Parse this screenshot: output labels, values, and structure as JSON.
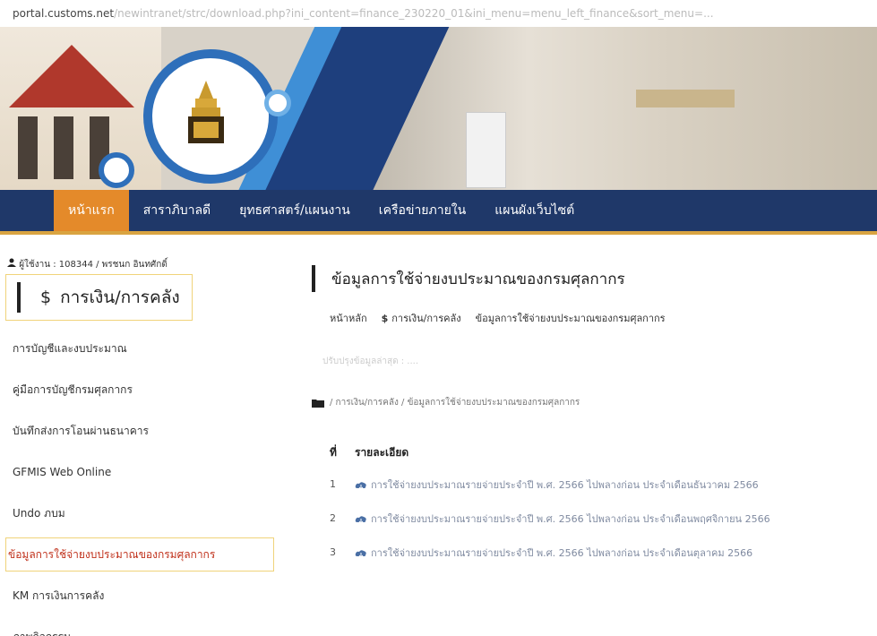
{
  "url": {
    "host": "portal.customs.net",
    "path": "/newintranet/strc/download.php?ini_content=finance_230220_01&ini_menu=menu_left_finance&sort_menu=..."
  },
  "nav": {
    "items": [
      {
        "label": "หน้าแรก"
      },
      {
        "label": "สาราภิบาลดี"
      },
      {
        "label": "ยุทธศาสตร์/แผนงาน"
      },
      {
        "label": "เครือข่ายภายใน"
      },
      {
        "label": "แผนผังเว็บไซต์"
      }
    ]
  },
  "sidebar": {
    "user": "ผู้ใช้งาน : 108344 / พรชนก อินทศักดิ์",
    "category_icon": "$",
    "category": "การเงิน/การคลัง",
    "menu": [
      {
        "label": "การบัญชีและงบประมาณ"
      },
      {
        "label": "คู่มือการบัญชีกรมศุลกากร"
      },
      {
        "label": "บันทึกส่งการโอนผ่านธนาคาร"
      },
      {
        "label": "GFMIS Web Online"
      },
      {
        "label": "Undo ภบม"
      },
      {
        "label": "ข้อมูลการใช้จ่ายงบประมาณของกรมศุลกากร"
      },
      {
        "label": "KM การเงินการคลัง"
      },
      {
        "label": "ภาพกิจกรรม"
      }
    ]
  },
  "main": {
    "title": "ข้อมูลการใช้จ่ายงบประมาณของกรมศุลกากร",
    "breadcrumb": [
      {
        "label": "หน้าหลัก"
      },
      {
        "icon": "$",
        "label": "การเงิน/การคลัง"
      },
      {
        "label": "ข้อมูลการใช้จ่ายงบประมาณของกรมศุลกากร"
      }
    ],
    "faint_text": "ปรับปรุงข้อมูลล่าสุด : ....",
    "path": "/ การเงิน/การคลัง / ข้อมูลการใช้จ่ายงบประมาณของกรมศุลกากร",
    "table_header": {
      "no": "ที่",
      "detail": "รายละเอียด"
    },
    "rows": [
      {
        "no": "1",
        "text": "การใช้จ่ายงบประมาณรายจ่ายประจำปี พ.ศ. 2566 ไปพลางก่อน ประจำเดือนธันวาคม 2566"
      },
      {
        "no": "2",
        "text": "การใช้จ่ายงบประมาณรายจ่ายประจำปี พ.ศ. 2566 ไปพลางก่อน ประจำเดือนพฤศจิกายน 2566"
      },
      {
        "no": "3",
        "text": "การใช้จ่ายงบประมาณรายจ่ายประจำปี พ.ศ. 2566 ไปพลางก่อน ประจำเดือนตุลาคม 2566"
      }
    ]
  },
  "colors": {
    "nav_bg": "#1f3869",
    "nav_active": "#e48a2a",
    "menu_active": "#c0311b",
    "link": "#7f8aa0"
  }
}
